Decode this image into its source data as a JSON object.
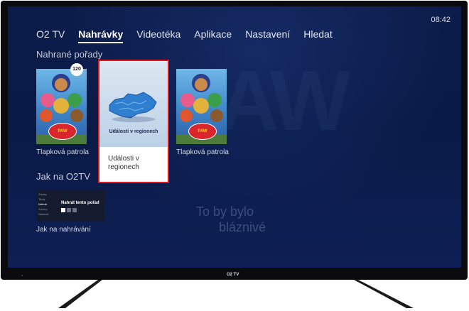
{
  "status": {
    "time": "08:42"
  },
  "nav": {
    "items": [
      {
        "label": "O2 TV",
        "active": false
      },
      {
        "label": "Nahrávky",
        "active": true
      },
      {
        "label": "Videotéka",
        "active": false
      },
      {
        "label": "Aplikace",
        "active": false
      },
      {
        "label": "Nastavení",
        "active": false
      },
      {
        "label": "Hledat",
        "active": false
      }
    ]
  },
  "recorded": {
    "title": "Nahrané pořady",
    "items": [
      {
        "label": "Tlapková patrola",
        "badge": "120",
        "poster_text": "PAW PATROL"
      },
      {
        "label": "Události v regionech",
        "thumb_caption": "Události v regionech",
        "focused": true
      },
      {
        "label": "Tlapková patrola",
        "poster_text": "PAW PATROL"
      }
    ]
  },
  "howto": {
    "title": "Jak na O2TV",
    "thumb_menu": [
      "Zápisy",
      "Tituly",
      "Nahrát",
      "Zdroby",
      "Nastavit"
    ],
    "thumb_menu_selected": 2,
    "thumb_text": "Nahrát tento pořad",
    "label": "Jak na nahrávání"
  },
  "background": {
    "ghost_text_line1": "To by bylo",
    "ghost_text_line2": "bláznivé"
  },
  "tv": {
    "brand": "O2 TV"
  },
  "colors": {
    "focus_border": "#e0161b",
    "screen_bg": "#0c1c4a"
  }
}
